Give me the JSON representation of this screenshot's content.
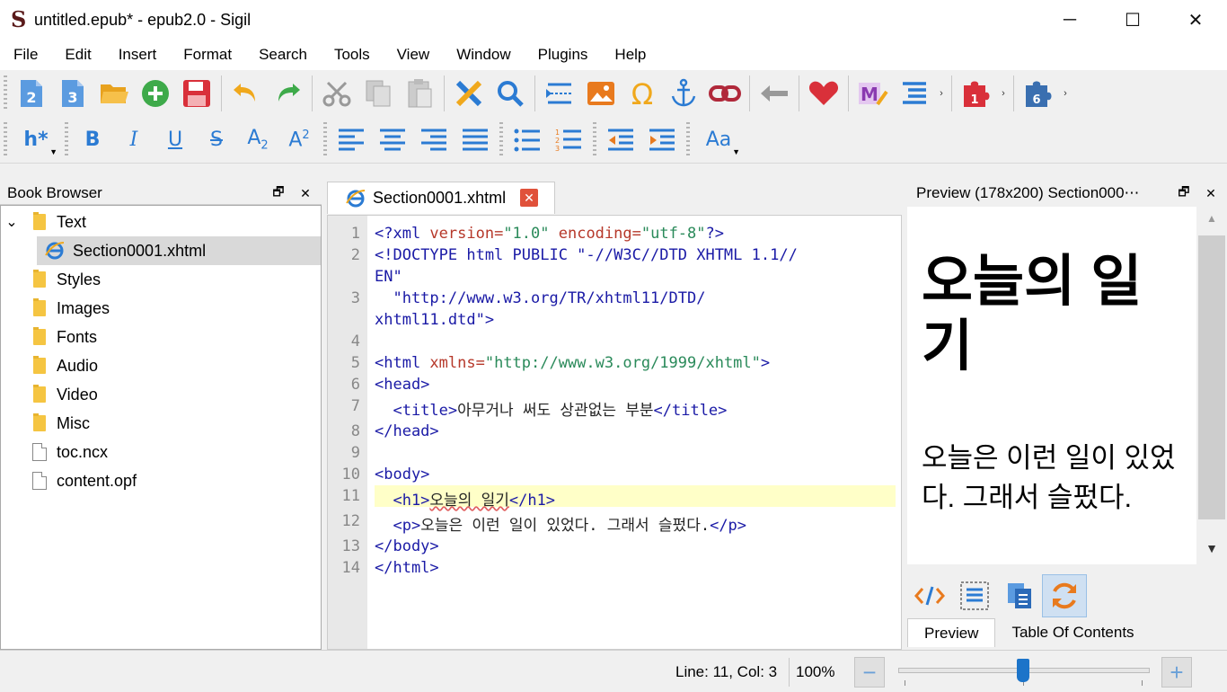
{
  "window": {
    "title": "untitled.epub* - epub2.0 - Sigil",
    "logo_letter": "S",
    "controls": {
      "minimize": "─",
      "maximize": "☐",
      "close": "✕"
    }
  },
  "menu": [
    "File",
    "Edit",
    "Insert",
    "Format",
    "Search",
    "Tools",
    "View",
    "Window",
    "Plugins",
    "Help"
  ],
  "toolbar1": {
    "epub2_label": "2",
    "epub3_label": "3",
    "plugin1_badge": "1",
    "plugin6_badge": "6",
    "more": "›"
  },
  "toolbar2": {
    "heading": "h*",
    "bold": "B",
    "italic": "I",
    "underline": "U",
    "strike": "S",
    "subscript_main": "A",
    "subscript_sub": "2",
    "superscript_main": "A",
    "superscript_sup": "2",
    "case": "Aa"
  },
  "book_browser": {
    "title": "Book Browser",
    "items": [
      {
        "label": "Text",
        "type": "folder",
        "expanded": true
      },
      {
        "label": "Section0001.xhtml",
        "type": "html",
        "selected": true
      },
      {
        "label": "Styles",
        "type": "folder"
      },
      {
        "label": "Images",
        "type": "folder"
      },
      {
        "label": "Fonts",
        "type": "folder"
      },
      {
        "label": "Audio",
        "type": "folder"
      },
      {
        "label": "Video",
        "type": "folder"
      },
      {
        "label": "Misc",
        "type": "folder"
      },
      {
        "label": "toc.ncx",
        "type": "file"
      },
      {
        "label": "content.opf",
        "type": "file"
      }
    ],
    "expand_arrow": "⌄"
  },
  "editor": {
    "tab_label": "Section0001.xhtml",
    "tab_close": "✕",
    "line_numbers": [
      "1",
      "2",
      "3",
      "4",
      "5",
      "6",
      "7",
      "8",
      "9",
      "10",
      "11",
      "12",
      "13",
      "14"
    ],
    "code": {
      "l1a": "<?xml ",
      "l1b": "version=",
      "l1c": "\"1.0\"",
      "l1d": " encoding=",
      "l1e": "\"utf-8\"",
      "l1f": "?>",
      "l2a": "<!DOCTYPE html PUBLIC \"-//W3C//DTD XHTML 1.1//",
      "l2b": "EN\"",
      "l3a": "  \"http://www.w3.org/TR/xhtml11/DTD/",
      "l3b": "xhtml11.dtd\">",
      "l5a": "<html ",
      "l5b": "xmlns=",
      "l5c": "\"http://www.w3.org/1999/xhtml\"",
      "l5d": ">",
      "l6": "<head>",
      "l7a": "  <title>",
      "l7b": "아무거나 써도 상관없는 부분",
      "l7c": "</title>",
      "l8": "</head>",
      "l10": "<body>",
      "l11a": "  <h1>",
      "l11b": "오늘의 일기",
      "l11c": "</h1>",
      "l12a": "  <p>",
      "l12b": "오늘은 이런 일이 있었다. 그래서 슬펐다.",
      "l12c": "</p>",
      "l13": "</body>",
      "l14": "</html>"
    }
  },
  "preview": {
    "title": "Preview (178x200) Section000⋯",
    "h1": "오늘의 일기",
    "p": "오늘은 이런 일이 있었다. 그래서 슬펐다.",
    "tabs": [
      "Preview",
      "Table Of Contents"
    ],
    "scroll_up": "▲",
    "scroll_down": "▼"
  },
  "status": {
    "position": "Line: 11, Col: 3",
    "zoom": "100%",
    "zoom_out": "−",
    "zoom_in": "+"
  },
  "colors": {
    "accent": "#2b7bd3",
    "tag": "#1a1aa6",
    "attr": "#b6382a",
    "value": "#2a8a5a",
    "highlight": "#ffffc8"
  }
}
